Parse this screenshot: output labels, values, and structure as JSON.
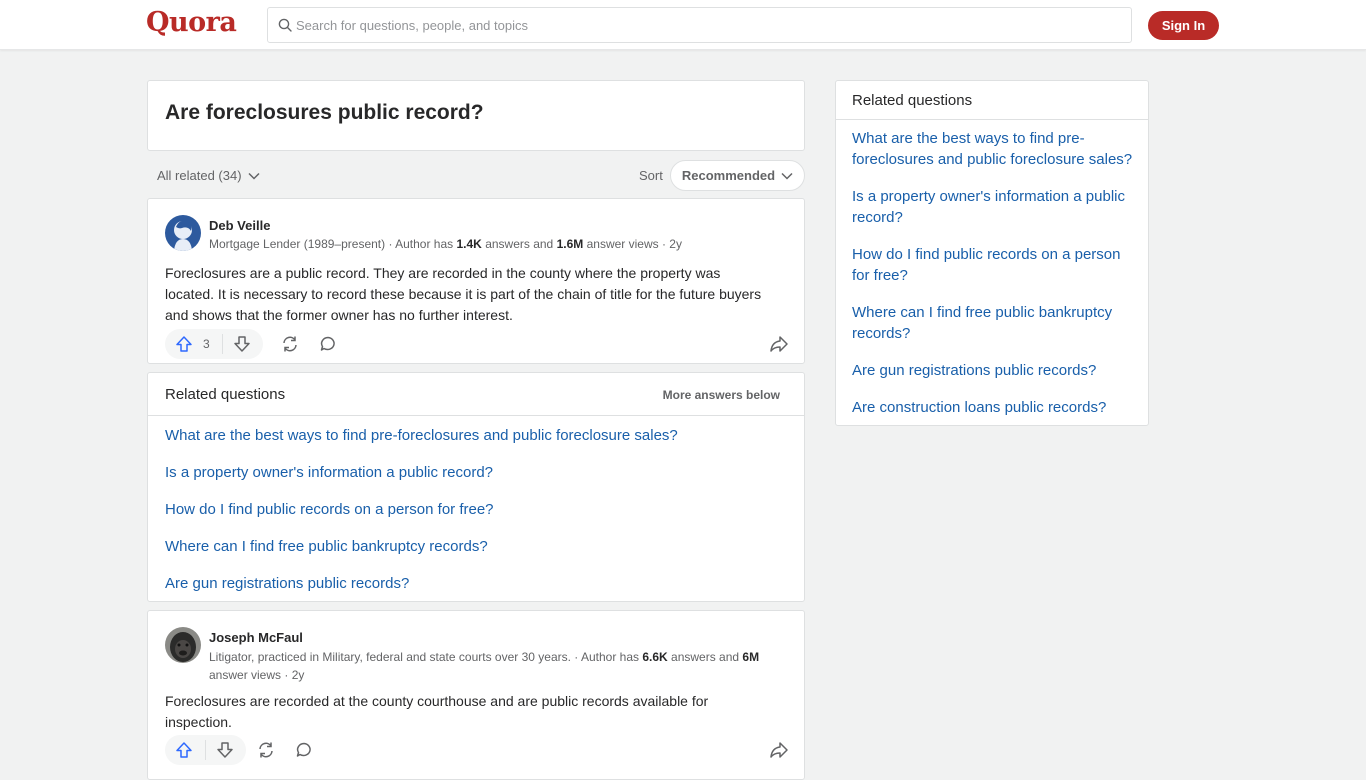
{
  "header": {
    "logo": "Quora",
    "search_placeholder": "Search for questions, people, and topics",
    "sign_in": "Sign In",
    "brand_color": "#b92b27"
  },
  "question": {
    "title": "Are foreclosures public record?"
  },
  "filters": {
    "all_related": "All related (34)",
    "sort_label": "Sort",
    "sort_value": "Recommended"
  },
  "answers": [
    {
      "author": "Deb Veille",
      "cred_prefix": "Mortgage Lender (1989–present) · Author has ",
      "answers_count": "1.4K",
      "cred_mid": " answers and ",
      "views_count": "1.6M",
      "cred_suffix": " answer views · 2y",
      "text": "Foreclosures are a public record. They are recorded in the county where the property was located. It is necessary to record these because it is part of the chain of title for the future buyers and shows that the former owner has no further interest.",
      "upvotes": "3"
    },
    {
      "author": "Joseph McFaul",
      "cred_prefix": "Litigator, practiced in Military, federal and state courts over 30 years. · Author has ",
      "answers_count": "6.6K",
      "cred_mid": " answers and ",
      "views_count": "6M",
      "cred_suffix": " answer views · 2y",
      "text": "Foreclosures are recorded at the county courthouse and are public records available for inspection.",
      "upvotes": ""
    }
  ],
  "related_inline": {
    "title": "Related questions",
    "more": "More answers below",
    "items": [
      "What are the best ways to find pre-foreclosures and public foreclosure sales?",
      "Is a property owner's information a public record?",
      "How do I find public records on a person for free?",
      "Where can I find free public bankruptcy records?",
      "Are gun registrations public records?"
    ]
  },
  "related_side": {
    "title": "Related questions",
    "items": [
      "What are the best ways to find pre-foreclosures and public foreclosure sales?",
      "Is a property owner's information a public record?",
      "How do I find public records on a person for free?",
      "Where can I find free public bankruptcy records?",
      "Are gun registrations public records?",
      "Are construction loans public records?"
    ]
  }
}
